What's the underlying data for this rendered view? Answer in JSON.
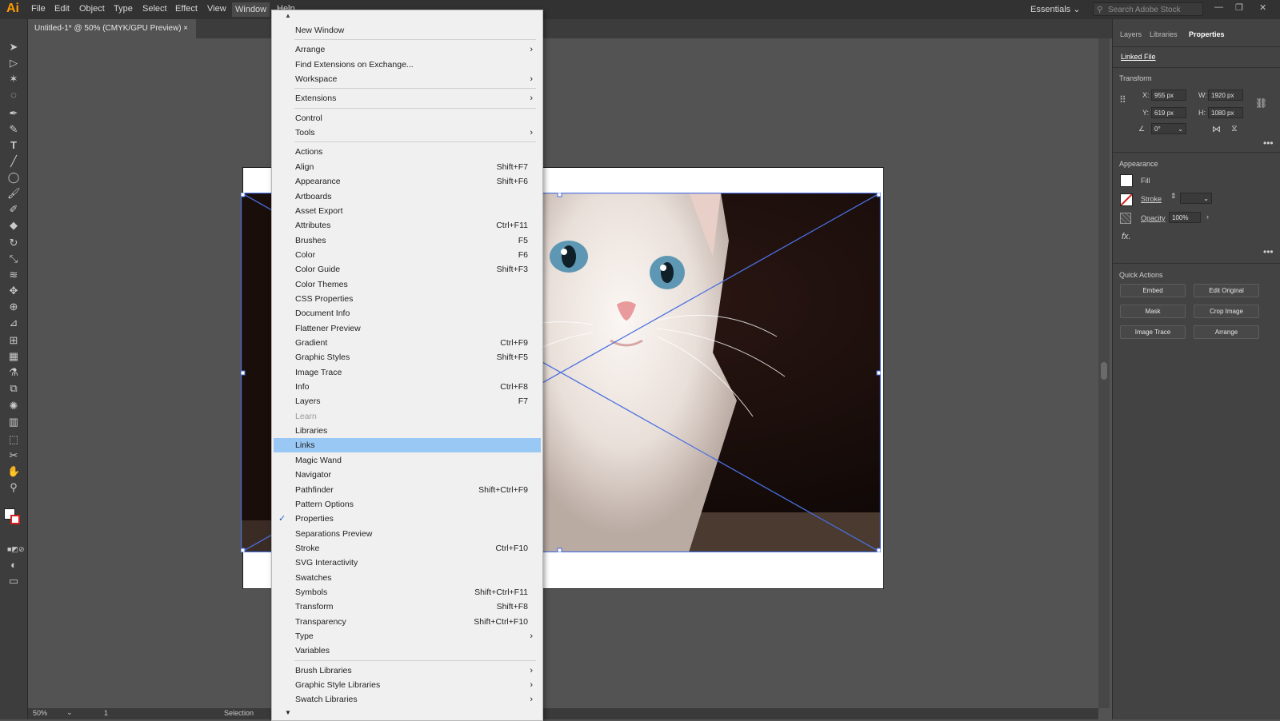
{
  "app": {
    "logo": "Ai"
  },
  "menubar": {
    "items": [
      "File",
      "Edit",
      "Object",
      "Type",
      "Select",
      "Effect",
      "View",
      "Window",
      "Help"
    ],
    "workspace": "Essentials",
    "search_placeholder": "Search Adobe Stock"
  },
  "document": {
    "tab_title": "Untitled-1* @ 50% (CMYK/GPU Preview)",
    "close": "×"
  },
  "status": {
    "zoom": "50%",
    "artboard": "1",
    "tool": "Selection"
  },
  "window_menu": {
    "groups": [
      [
        {
          "label": "New Window"
        }
      ],
      [
        {
          "label": "Arrange",
          "submenu": true
        },
        {
          "label": "Find Extensions on Exchange..."
        },
        {
          "label": "Workspace",
          "submenu": true
        }
      ],
      [
        {
          "label": "Extensions",
          "submenu": true
        }
      ],
      [
        {
          "label": "Control"
        },
        {
          "label": "Tools",
          "submenu": true
        }
      ],
      [
        {
          "label": "Actions"
        },
        {
          "label": "Align",
          "shortcut": "Shift+F7"
        },
        {
          "label": "Appearance",
          "shortcut": "Shift+F6"
        },
        {
          "label": "Artboards"
        },
        {
          "label": "Asset Export"
        },
        {
          "label": "Attributes",
          "shortcut": "Ctrl+F11"
        },
        {
          "label": "Brushes",
          "shortcut": "F5"
        },
        {
          "label": "Color",
          "shortcut": "F6"
        },
        {
          "label": "Color Guide",
          "shortcut": "Shift+F3"
        },
        {
          "label": "Color Themes"
        },
        {
          "label": "CSS Properties"
        },
        {
          "label": "Document Info"
        },
        {
          "label": "Flattener Preview"
        },
        {
          "label": "Gradient",
          "shortcut": "Ctrl+F9"
        },
        {
          "label": "Graphic Styles",
          "shortcut": "Shift+F5"
        },
        {
          "label": "Image Trace"
        },
        {
          "label": "Info",
          "shortcut": "Ctrl+F8"
        },
        {
          "label": "Layers",
          "shortcut": "F7"
        },
        {
          "label": "Learn",
          "disabled": true
        },
        {
          "label": "Libraries"
        },
        {
          "label": "Links",
          "highlighted": true
        },
        {
          "label": "Magic Wand"
        },
        {
          "label": "Navigator"
        },
        {
          "label": "Pathfinder",
          "shortcut": "Shift+Ctrl+F9"
        },
        {
          "label": "Pattern Options"
        },
        {
          "label": "Properties",
          "checked": true
        },
        {
          "label": "Separations Preview"
        },
        {
          "label": "Stroke",
          "shortcut": "Ctrl+F10"
        },
        {
          "label": "SVG Interactivity"
        },
        {
          "label": "Swatches"
        },
        {
          "label": "Symbols",
          "shortcut": "Shift+Ctrl+F11"
        },
        {
          "label": "Transform",
          "shortcut": "Shift+F8"
        },
        {
          "label": "Transparency",
          "shortcut": "Shift+Ctrl+F10"
        },
        {
          "label": "Type",
          "submenu": true
        },
        {
          "label": "Variables"
        }
      ],
      [
        {
          "label": "Brush Libraries",
          "submenu": true
        },
        {
          "label": "Graphic Style Libraries",
          "submenu": true
        },
        {
          "label": "Swatch Libraries",
          "submenu": true
        }
      ]
    ]
  },
  "right_panel": {
    "tabs": [
      "Layers",
      "Libraries",
      "Properties"
    ],
    "active_tab": "Properties",
    "linked_file": "Linked File",
    "transform": {
      "title": "Transform",
      "x_label": "X:",
      "x": "955 px",
      "y_label": "Y:",
      "y": "619 px",
      "w_label": "W:",
      "w": "1920 px",
      "h_label": "H:",
      "h": "1080 px",
      "angle": "0°"
    },
    "appearance": {
      "title": "Appearance",
      "fill": "Fill",
      "stroke": "Stroke",
      "opacity_label": "Opacity",
      "opacity": "100%",
      "fx": "fx."
    },
    "quick_actions": {
      "title": "Quick Actions",
      "buttons": [
        "Embed",
        "Edit Original",
        "Mask",
        "Crop Image",
        "Image Trace",
        "Arrange"
      ]
    }
  },
  "colors": {
    "accent_blue": "#4a6fe0",
    "menu_highlight": "#99c8f5",
    "logo": "#ff9a00"
  }
}
